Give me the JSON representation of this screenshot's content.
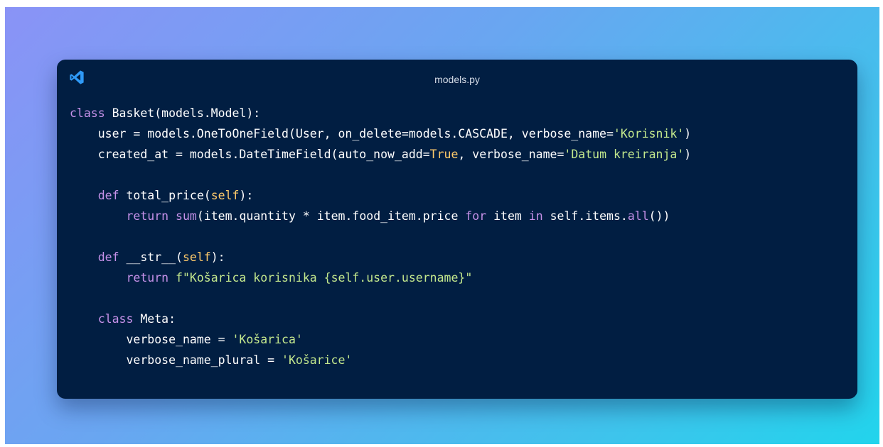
{
  "window": {
    "filename": "models.py",
    "logo_icon": "vscode-icon",
    "accent_color": "#2f9af7"
  },
  "code_lines": [
    [
      {
        "t": "class ",
        "c": "kw"
      },
      {
        "t": "Basket(models.Model):",
        "c": ""
      }
    ],
    [
      {
        "t": "    user = models.OneToOneField(User, on_delete=models.CASCADE, verbose_name=",
        "c": ""
      },
      {
        "t": "'Korisnik'",
        "c": "str"
      },
      {
        "t": ")",
        "c": ""
      }
    ],
    [
      {
        "t": "    created_at = models.DateTimeField(auto_now_add=",
        "c": ""
      },
      {
        "t": "True",
        "c": "const"
      },
      {
        "t": ", verbose_name=",
        "c": ""
      },
      {
        "t": "'Datum kreiranja'",
        "c": "str"
      },
      {
        "t": ")",
        "c": ""
      }
    ],
    [],
    [
      {
        "t": "    ",
        "c": ""
      },
      {
        "t": "def ",
        "c": "kw"
      },
      {
        "t": "total_price(",
        "c": ""
      },
      {
        "t": "self",
        "c": "self"
      },
      {
        "t": "):",
        "c": ""
      }
    ],
    [
      {
        "t": "        ",
        "c": ""
      },
      {
        "t": "return ",
        "c": "kw"
      },
      {
        "t": "sum",
        "c": "builtin"
      },
      {
        "t": "(item.quantity * item.food_item.price ",
        "c": ""
      },
      {
        "t": "for ",
        "c": "kw"
      },
      {
        "t": "item ",
        "c": ""
      },
      {
        "t": "in ",
        "c": "kw"
      },
      {
        "t": "self.items.",
        "c": ""
      },
      {
        "t": "all",
        "c": "builtin"
      },
      {
        "t": "())",
        "c": ""
      }
    ],
    [],
    [
      {
        "t": "    ",
        "c": ""
      },
      {
        "t": "def ",
        "c": "kw"
      },
      {
        "t": "__str__(",
        "c": ""
      },
      {
        "t": "self",
        "c": "self"
      },
      {
        "t": "):",
        "c": ""
      }
    ],
    [
      {
        "t": "        ",
        "c": ""
      },
      {
        "t": "return ",
        "c": "kw"
      },
      {
        "t": "f\"Košarica korisnika {self.user.username}\"",
        "c": "str"
      }
    ],
    [],
    [
      {
        "t": "    ",
        "c": ""
      },
      {
        "t": "class ",
        "c": "kw"
      },
      {
        "t": "Meta:",
        "c": ""
      }
    ],
    [
      {
        "t": "        verbose_name = ",
        "c": ""
      },
      {
        "t": "'Košarica'",
        "c": "str"
      }
    ],
    [
      {
        "t": "        verbose_name_plural = ",
        "c": ""
      },
      {
        "t": "'Košarice'",
        "c": "str"
      }
    ]
  ]
}
